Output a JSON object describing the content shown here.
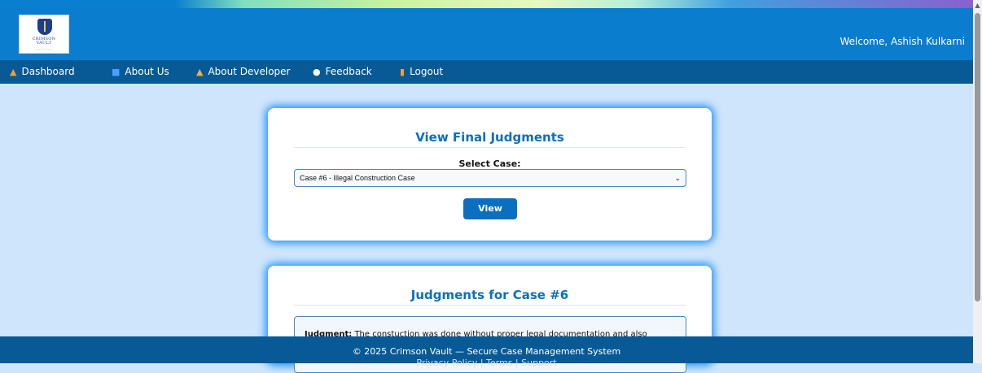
{
  "header": {
    "welcome": "Welcome, Ashish Kulkarni",
    "logo_brand_line1": "CRIMSON",
    "logo_brand_line2": "VAULT"
  },
  "nav": {
    "items": [
      {
        "label": "Dashboard",
        "icon": "dashboard-icon"
      },
      {
        "label": "About Us",
        "icon": "info-icon"
      },
      {
        "label": "About Developer",
        "icon": "developer-icon"
      },
      {
        "label": "Feedback",
        "icon": "feedback-icon"
      },
      {
        "label": "Logout",
        "icon": "logout-icon"
      }
    ]
  },
  "view_card": {
    "title": "View Final Judgments",
    "select_label": "Select Case:",
    "selected_case": "Case #6 - Illegal Construction Case",
    "view_button": "View"
  },
  "judgments_card": {
    "title": "Judgments for Case #6",
    "judgment_label": "Judgment:",
    "judgment_text": "The constuction was done without proper legal documentation and also"
  },
  "footer": {
    "copyright": "© 2025 Crimson Vault — Secure Case Management System",
    "links": "Privacy Policy | Terms | Support"
  },
  "colors": {
    "header": "#0b7dcf",
    "nav": "#075a96",
    "accent": "#0b6fbf",
    "background": "#cfe5fb"
  }
}
